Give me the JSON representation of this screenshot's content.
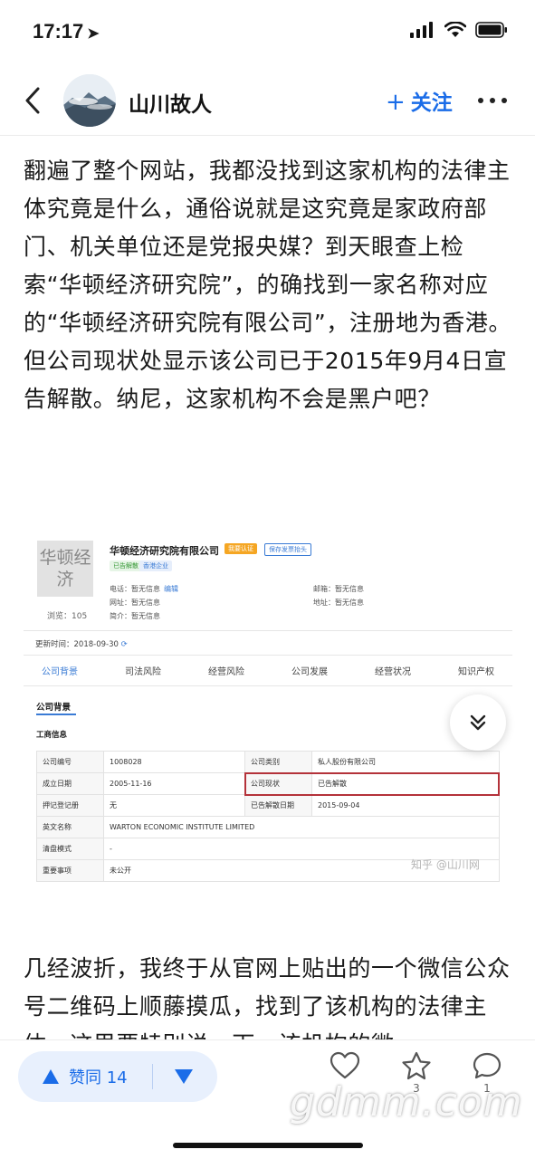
{
  "status_bar": {
    "time": "17:17"
  },
  "nav": {
    "author_name": "山川故人",
    "follow_label": "关注"
  },
  "article": {
    "para1": "翻遍了整个网站，我都没找到这家机构的法律主体究竟是什么，通俗说就是这究竟是家政府部门、机关单位还是党报央媒？到天眼查上检索“华顿经济研究院”，的确找到一家名称对应的“华顿经济研究院有限公司”，注册地为香港。但公司现状处显示该公司已于2015年9月4日宣告解散。纳尼，这家机构不会是黑户吧？",
    "para2": "几经波折，我终于从官网上贴出的一个微信公众号二维码上顺藤摸瓜，找到了该机构的法律主体，这里要特别说一下，该机构的微"
  },
  "embed": {
    "logo_text": "华顿经济",
    "views": "浏览：105",
    "company_name": "华顿经济研究院有限公司",
    "tag_claim": "我要认证",
    "tag_report": "保存发票抬头",
    "tag_status": "已告解散",
    "tag_region": "香港企业",
    "phone": "电话：暂无信息",
    "edit": "编辑",
    "website": "网址：暂无信息",
    "intro": "简介：暂无信息",
    "email": "邮箱：暂无信息",
    "address": "地址：暂无信息",
    "update_time": "更新时间：2018-09-30",
    "tabs": [
      "公司背景",
      "司法风险",
      "经营风险",
      "公司发展",
      "经营状况",
      "知识产权"
    ],
    "section_title": "公司背景",
    "sub_title": "工商信息",
    "rows": [
      [
        "公司编号",
        "1008028",
        "公司类别",
        "私人股份有限公司"
      ],
      [
        "成立日期",
        "2005-11-16",
        "公司现状",
        "已告解散"
      ],
      [
        "押记登记册",
        "无",
        "已告解散日期",
        "2015-09-04"
      ],
      [
        "英文名称",
        "WARTON ECONOMIC INSTITUTE LIMITED",
        "",
        ""
      ],
      [
        "清盘模式",
        "-",
        "",
        ""
      ],
      [
        "重要事项",
        "未公开",
        "",
        ""
      ]
    ],
    "watermark": "知乎 @山川网"
  },
  "bottom_bar": {
    "vote_label": "赞同 14",
    "like_count": "",
    "fav_count": "3",
    "comment_count": "1"
  },
  "site_watermark": "gdmm.com",
  "colors": {
    "accent": "#1a6ce8",
    "highlight": "#b4323a"
  }
}
